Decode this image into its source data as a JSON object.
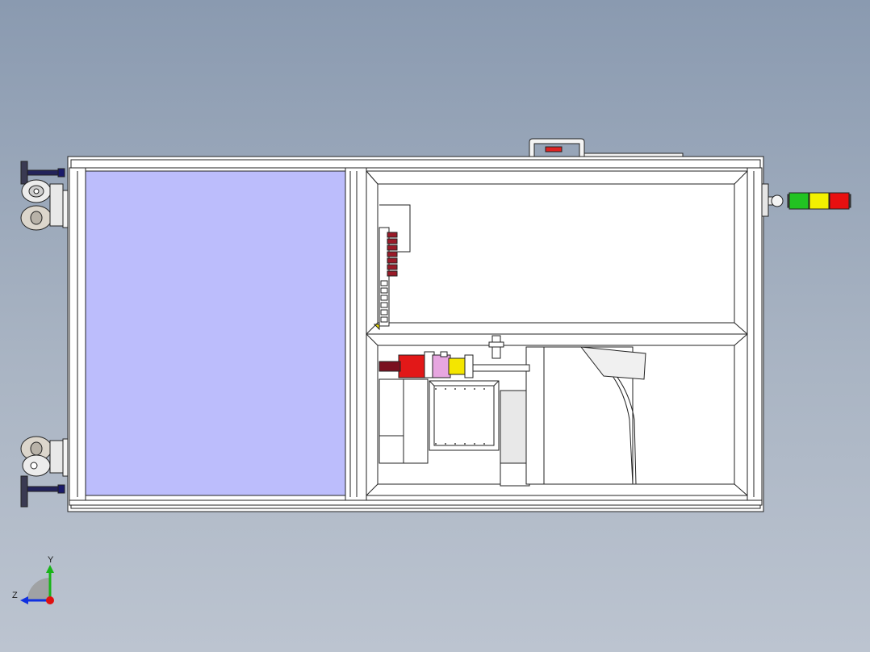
{
  "viewport": {
    "background_top": "#8a9ab0",
    "background_bottom": "#bcc4d0"
  },
  "model": {
    "name": "machine-enclosure-top-view",
    "glass_panel_color": "#bcbdfc",
    "frame_color": "#ffffff",
    "stroke_color": "#222222"
  },
  "signal_tower": {
    "lamps": [
      {
        "name": "green",
        "color": "#22c322"
      },
      {
        "name": "yellow",
        "color": "#f2f000"
      },
      {
        "name": "red",
        "color": "#e81010"
      }
    ]
  },
  "components": {
    "motor_housing_color": "#e21818",
    "coupling_color": "#f4e600",
    "pink_block_color": "#e7a6e0"
  },
  "triad": {
    "x_axis_color": "#e01010",
    "y_axis_color": "#18b418",
    "z_axis_color": "#1030e0",
    "y_label": "Y",
    "z_label": "Z"
  }
}
